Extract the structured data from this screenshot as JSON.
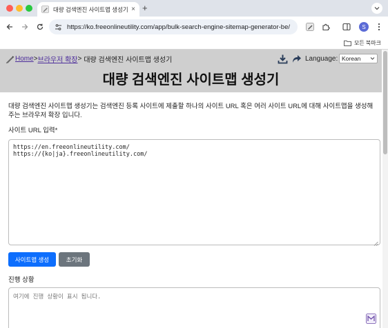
{
  "browser": {
    "tab_title": "대량 검색엔진 사이트맵 생성기 - E",
    "tab_close": "×",
    "new_tab": "+",
    "url": "https://ko.freeonlineutility.com/app/bulk-search-engine-sitemap-generator-be/",
    "profile_initial": "S",
    "bookmarks_all": "모든 북마크",
    "icons": [
      "back-icon",
      "forward-icon",
      "reload-icon",
      "site-info-icon",
      "extension-icon",
      "sidebar-icon",
      "profile-icon",
      "menu-icon",
      "folder-icon"
    ]
  },
  "header": {
    "breadcrumb": {
      "home": "Home",
      "separator1": ">",
      "category": "브라우저 확장",
      "separator2": ">",
      "current": "대량 검색엔진 사이트맵 생성기"
    },
    "language_label": "Language:",
    "language_value": "Korean",
    "title": "대량 검색엔진 사이트맵 생성기"
  },
  "main": {
    "description": "대량 검색엔진 사이트맵 생성기는 검색엔진 등록 사이트에 제출할 하나의 사이트 URL 혹은 여러 사이트 URL에 대해 사이트맵을 생성해 주는 브라우저 확장 입니다.",
    "url_label": "사이트 URL 입력*",
    "url_lines": [
      "https://en.freeonlineutility.com/",
      "https://{ko|ja}.freeonlineutility.com/"
    ],
    "generate_button": "사이트맵 생성",
    "reset_button": "초기화",
    "progress_label": "진행 상황",
    "progress_placeholder": "여기에 진행 상황이 표시 됩니다."
  },
  "colors": {
    "primary": "#0d6efd",
    "secondary": "#6c757d",
    "header_bg": "#cfcfcf",
    "link": "#4b2b9a"
  }
}
